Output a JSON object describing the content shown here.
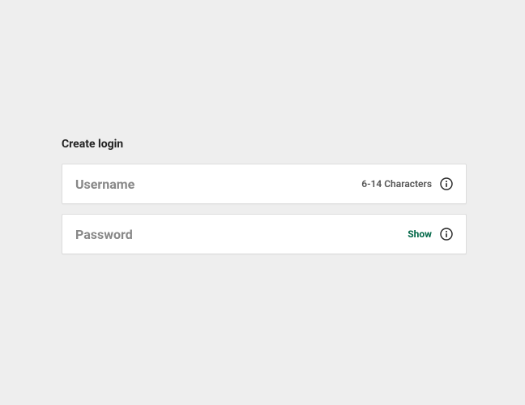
{
  "heading": "Create login",
  "username": {
    "placeholder": "Username",
    "hint": "6-14 Characters"
  },
  "password": {
    "placeholder": "Password",
    "show_label": "Show"
  }
}
